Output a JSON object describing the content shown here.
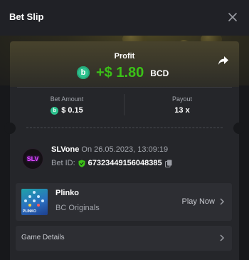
{
  "header": {
    "title": "Bet Slip",
    "close_icon": "close-icon"
  },
  "profit": {
    "label": "Profit",
    "amount": "+$ 1.80",
    "currency": "BCD",
    "coin_icon": "bcd-coin-icon",
    "share_icon": "share-arrow-icon",
    "amount_color": "#3bc117"
  },
  "stats": {
    "bet_amount_label": "Bet Amount",
    "bet_amount_value": "$ 0.15",
    "payout_label": "Payout",
    "payout_value": "13 x"
  },
  "bet": {
    "avatar_text": "SLV",
    "username": "SLVone",
    "time_text": "On 26.05.2023, 13:09:19",
    "bet_id_label": "Bet ID:",
    "bet_id": "67323449156048385",
    "verified_icon": "shield-check-icon",
    "copy_icon": "copy-icon"
  },
  "game": {
    "name": "Plinko",
    "provider": "BC Originals",
    "thumb_text": "PLINKO",
    "play_label": "Play Now",
    "chevron_icon": "chevron-right-icon"
  },
  "details": {
    "label": "Game Details"
  },
  "colors": {
    "background": "#17181b",
    "card": "#25262a",
    "accent_green": "#3bc117",
    "coin_green": "#2ec28f"
  }
}
